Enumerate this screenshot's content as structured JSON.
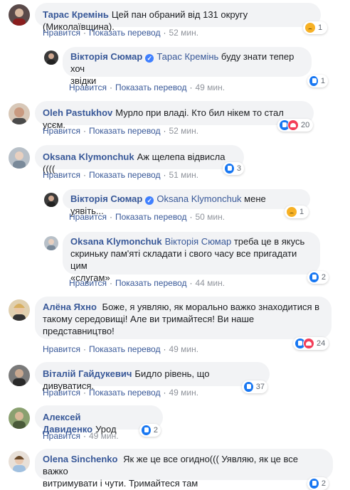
{
  "ui": {
    "like": "Нравится",
    "translate": "Показать перевод",
    "sep": "·"
  },
  "comments": [
    {
      "author": "Тарас Кремінь",
      "text": "Цей пан обраний від 131 округу (Миколаївщина).",
      "time": "52 мин.",
      "reactions": [
        "sad"
      ],
      "count": "1"
    },
    {
      "author": "Вікторія Сюмар",
      "verified": true,
      "mention": "Тарас Кремінь",
      "text": " буду знати тепер хоч",
      "text2": "звідки",
      "time": "49 мин.",
      "reactions": [
        "like"
      ],
      "count": "1"
    },
    {
      "author": "Oleh Pastukhov",
      "text": "Мурло при владі. Кто бил нікем то стал усєм.",
      "time": "52 мин.",
      "reactions": [
        "like",
        "love"
      ],
      "count": "20"
    },
    {
      "author": "Oksana Klymonchuk",
      "text": "Аж щелепа відвисла ((((",
      "time": "51 мин.",
      "reactions": [
        "like"
      ],
      "count": "3"
    },
    {
      "author": "Вікторія Сюмар",
      "verified": true,
      "mention": "Oksana Klymonchuk",
      "text": " мене уявіть...",
      "time": "50 мин.",
      "reactions": [
        "sad"
      ],
      "count": "1"
    },
    {
      "author": "Oksana Klymonchuk",
      "mention": "Вікторія Сюмар",
      "text": " треба це в якусь",
      "text2": "скриньку пам'яті складати і свого часу все пригадати цим",
      "text3": "«слугам»",
      "time": "44 мин.",
      "reactions": [
        "like"
      ],
      "count": "2"
    },
    {
      "author": "Алёна Яхно",
      "text": " Боже, я уявляю, як морально важко знаходитися в",
      "text2": "такому середовищі! Але ви тримайтеся! Ви наше",
      "text3": "представництво!",
      "time": "49 мин.",
      "reactions": [
        "like",
        "love"
      ],
      "count": "24"
    },
    {
      "author": "Віталій Гайдукевич",
      "text": "Бидло рівень, що дивуватися.",
      "time": "49 мин.",
      "reactions": [
        "like"
      ],
      "count": "37"
    },
    {
      "author": "Алексей Давиденко",
      "text": "Урод",
      "time": "49 мин.",
      "reactions": [
        "like"
      ],
      "count": "2"
    },
    {
      "author": "Olena Sinchenko",
      "text": " Як же це все огидно((( Уявляю, як це все важко",
      "text2": "витримувати і чути. Тримайтеся там",
      "time": "",
      "reactions": [
        "like"
      ],
      "count": "2"
    }
  ],
  "colors": {
    "link": "#385898",
    "bubble": "#f2f3f5",
    "like": "#1877f2",
    "love": "#f33e58",
    "sad": "#f7b125"
  }
}
